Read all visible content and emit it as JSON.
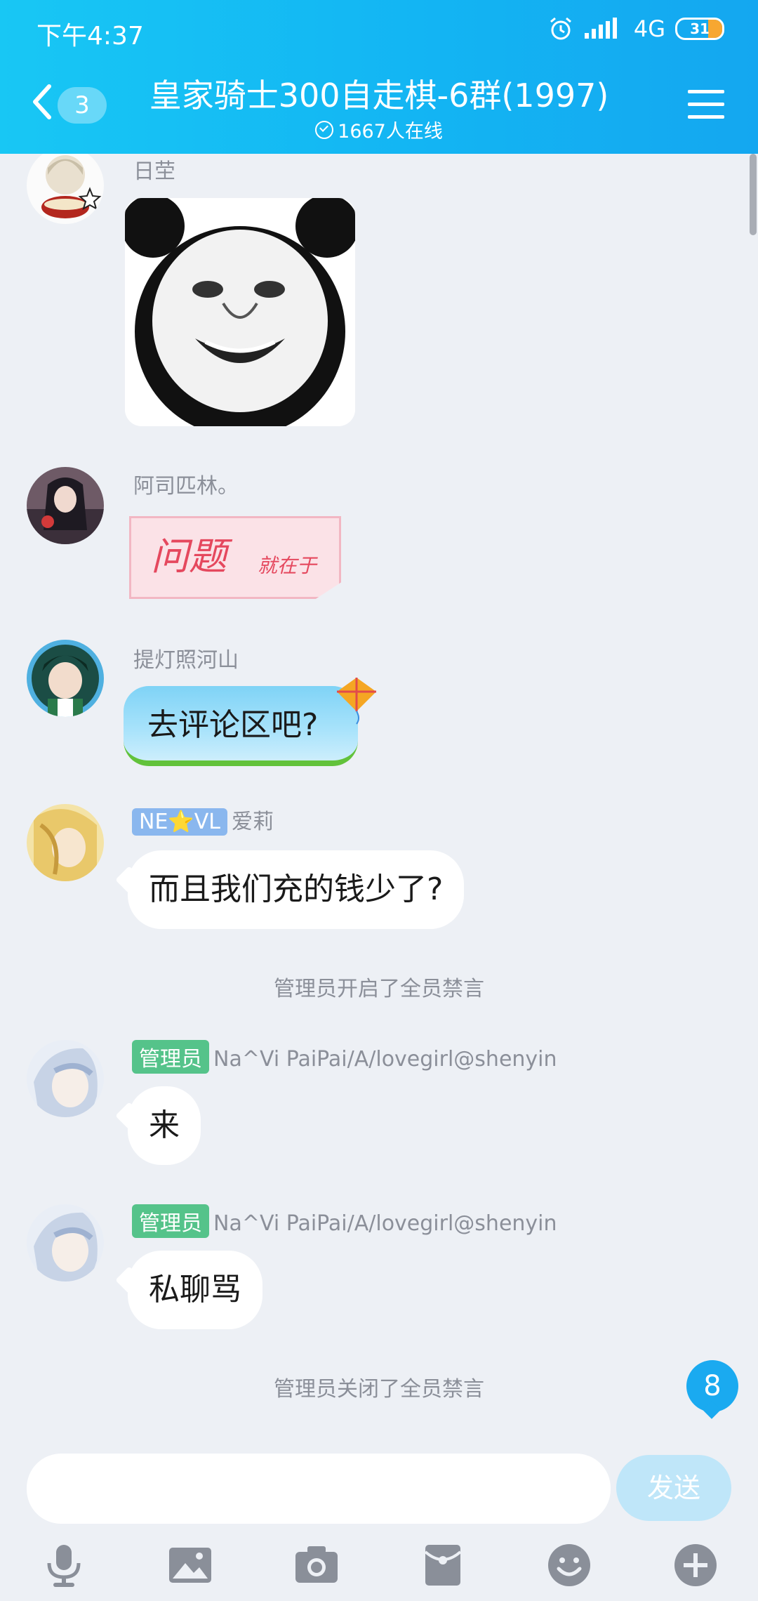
{
  "status_bar": {
    "time": "下午4:37",
    "network": "4G",
    "battery": "31"
  },
  "header": {
    "unread_count": "3",
    "title": "皇家骑士300自走棋-6群(1997)",
    "online": "1667人在线"
  },
  "messages": [
    {
      "sender": "日茔",
      "type": "sticker",
      "sticker": "panda-face"
    },
    {
      "sender": "阿司匹林。",
      "type": "sticker",
      "sticker_text_big": "问题",
      "sticker_text_small": "就在于"
    },
    {
      "sender": "提灯照河山",
      "type": "text",
      "text": "去评论区吧?"
    },
    {
      "tag": "NE⭐VL",
      "sender": "爱莉",
      "type": "text",
      "text": "而且我们充的钱少了?"
    },
    {
      "system": "管理员开启了全员禁言"
    },
    {
      "tag": "管理员",
      "sender": "Na^Vi   PaiPai/A/lovegirl@shenyin",
      "type": "text",
      "text": "来"
    },
    {
      "tag": "管理员",
      "sender": "Na^Vi   PaiPai/A/lovegirl@shenyin",
      "type": "text",
      "text": "私聊骂"
    },
    {
      "system": "管理员关闭了全员禁言"
    }
  ],
  "new_message_count": "8",
  "input": {
    "placeholder": "",
    "send_label": "发送"
  },
  "toolbar_icons": [
    "microphone-icon",
    "image-icon",
    "camera-icon",
    "red-packet-icon",
    "emoji-icon",
    "plus-icon"
  ],
  "colors": {
    "header": "#14b3f2",
    "background": "#edf0f5",
    "admin_tag": "#55c38a",
    "level_tag": "#8ab7ee",
    "send": "#bfe6f9"
  }
}
